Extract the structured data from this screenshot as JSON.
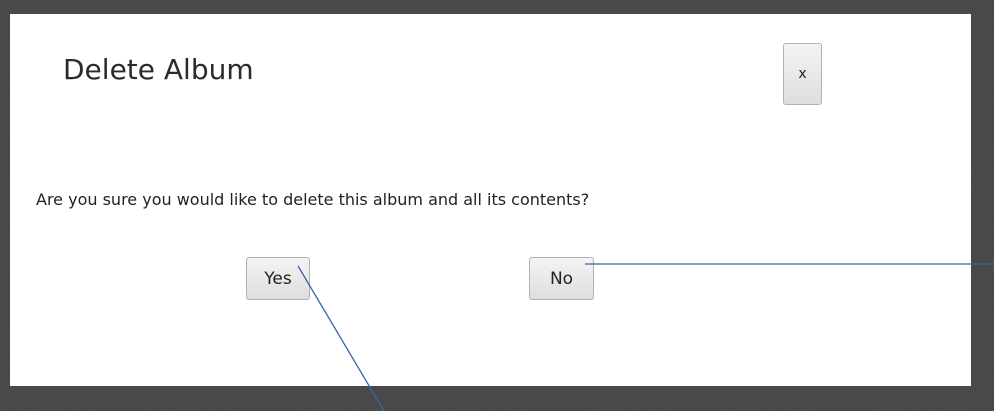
{
  "dialog": {
    "title": "Delete Album",
    "close_label": "x",
    "message": "Are you sure you would like to delete this album and all its contents?",
    "yes_label": "Yes",
    "no_label": "No"
  },
  "colors": {
    "backdrop": "#474747",
    "dialog_background": "#ffffff",
    "annotation_line": "#3b64a8"
  }
}
